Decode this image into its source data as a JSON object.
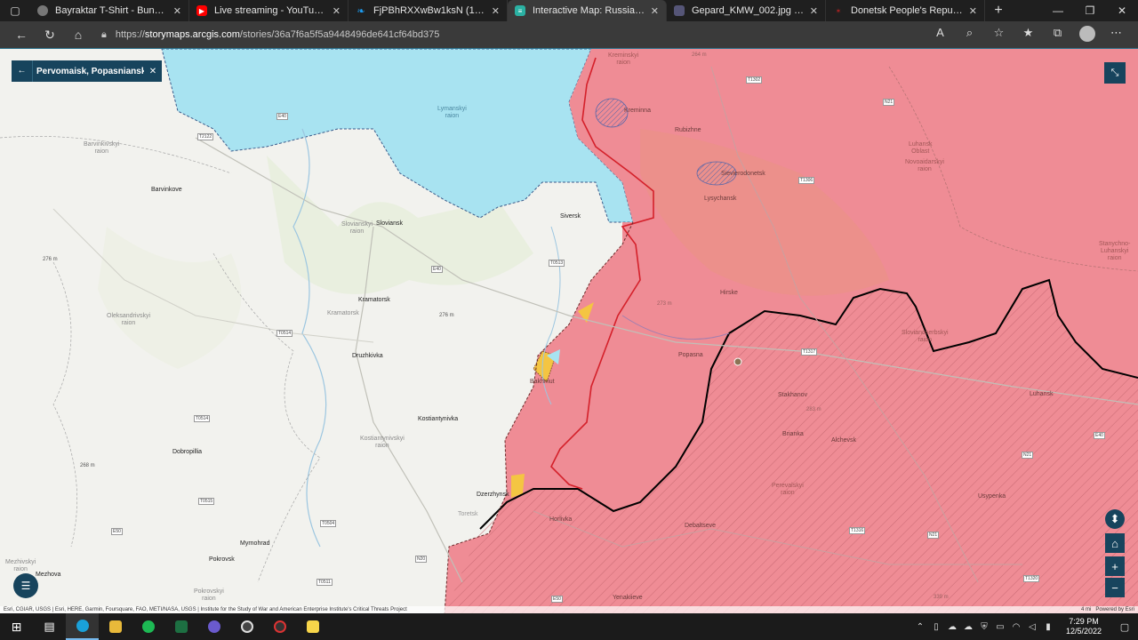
{
  "browser": {
    "tabs": [
      {
        "title": "Bayraktar T-Shirt - Bunker Brand",
        "favicon": "globe-icon",
        "color": "#777777"
      },
      {
        "title": "Live streaming - YouTube Studio",
        "favicon": "youtube-icon",
        "color": "#ff0000"
      },
      {
        "title": "FjPBhRXXwBw1ksN (1280×720)",
        "favicon": "twitter-icon",
        "color": "#1d9bf0"
      },
      {
        "title": "Interactive Map: Russia's Invasion",
        "favicon": "storymaps-icon",
        "color": "#2bb1a3"
      },
      {
        "title": "Gepard_KMW_002.jpg (1220×57",
        "favicon": "image-icon",
        "color": "#555577"
      },
      {
        "title": "Donetsk People's Republic Tank",
        "favicon": "wiki-icon",
        "color": "#aa2222"
      }
    ],
    "active_tab": 3,
    "url_prefix": "https://",
    "url_host": "storymaps.arcgis.com",
    "url_path": "/stories/36a7f6a5f5a9448496de641cf64bd375"
  },
  "map": {
    "panel_title": "Pervomaisk, Popasniansky",
    "attribution": "Esri, CGIAR, USGS | Esri, HERE, Garmin, Foursquare, FAO, METI/NASA, USGS | Institute for the Study of War and American Enterprise Institute's Critical Threats Project",
    "scale": "4 mi",
    "powered_by": "Powered by Esri",
    "colors": {
      "russian_controlled": "#ef8c95",
      "ukrainian_counteroffensive": "#a8e3f1",
      "contested": "#f4c542",
      "pre_2022": "#000000"
    },
    "cities": [
      {
        "name": "Kreminna"
      },
      {
        "name": "Rubizhne"
      },
      {
        "name": "Sievierodonetsk"
      },
      {
        "name": "Lysychansk"
      },
      {
        "name": "Siversk"
      },
      {
        "name": "Sloviansk"
      },
      {
        "name": "Kramatorsk"
      },
      {
        "name": "Druzhkivka"
      },
      {
        "name": "Kostiantynivka"
      },
      {
        "name": "Dobropillia"
      },
      {
        "name": "Barvinkove"
      },
      {
        "name": "Bakhmut"
      },
      {
        "name": "Popasna"
      },
      {
        "name": "Hirske"
      },
      {
        "name": "Stakhanov"
      },
      {
        "name": "Alchevsk"
      },
      {
        "name": "Brianka"
      },
      {
        "name": "Luhansk"
      },
      {
        "name": "Horlivka"
      },
      {
        "name": "Debaltseve"
      },
      {
        "name": "Dzerzhynsk"
      },
      {
        "name": "Toretsk"
      },
      {
        "name": "Myrnohrad"
      },
      {
        "name": "Pokrovsk"
      },
      {
        "name": "Yenakiieve"
      },
      {
        "name": "Usypenka"
      },
      {
        "name": "Mezhova"
      }
    ],
    "raions": [
      {
        "name": "Barvinkivskyi\nraion"
      },
      {
        "name": "Slovianskyi\nraion"
      },
      {
        "name": "Kramatorsk"
      },
      {
        "name": "Oleksandrivskyi\nraion"
      },
      {
        "name": "Kostiantynivskyi\nraion"
      },
      {
        "name": "Pokrovskyi\nraion"
      },
      {
        "name": "Lymanskyi\nraion"
      },
      {
        "name": "Luhansk\nOblast"
      },
      {
        "name": "Novoaidarskyi\nraion"
      },
      {
        "name": "Stanychno-\nLuhanskyi\nraion"
      },
      {
        "name": "Slovianoserbskyi\nraion"
      },
      {
        "name": "Perevalskyi\nraion"
      },
      {
        "name": "Kreminskyi\nraion"
      },
      {
        "name": "Mezhivskyi\nraion"
      }
    ],
    "roads": [
      "T2122",
      "E40",
      "T0513",
      "T0514",
      "E40",
      "T0514",
      "T0515",
      "T0504",
      "E50",
      "N20",
      "T0511",
      "T1302",
      "N21",
      "T1306",
      "T1317",
      "E40",
      "N21",
      "T1316",
      "N21",
      "E50",
      "T1320"
    ],
    "elevations": [
      "264 m",
      "276 m",
      "276 m",
      "268 m",
      "273 m",
      "283 m",
      "339 m"
    ]
  },
  "taskbar": {
    "time": "7:29 PM",
    "date": "12/5/2022"
  }
}
